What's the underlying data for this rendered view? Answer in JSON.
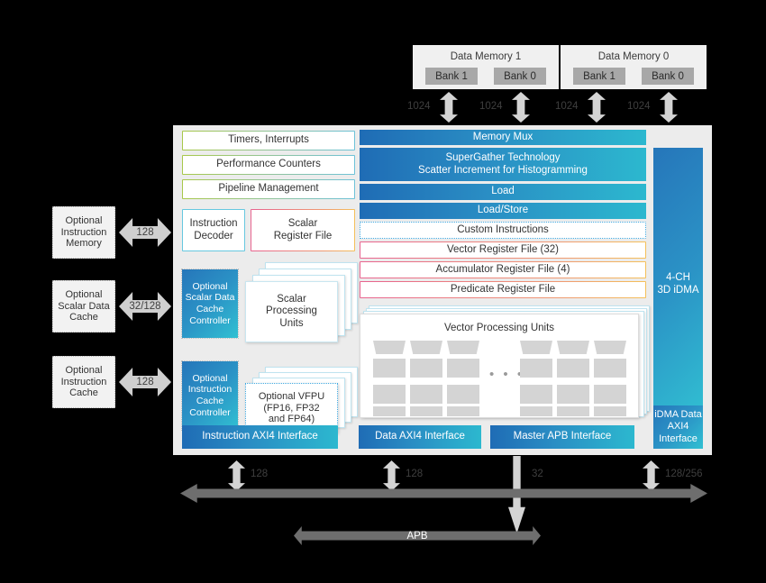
{
  "memories": [
    {
      "title": "Data Memory 1",
      "banks": [
        "Bank 1",
        "Bank 0"
      ]
    },
    {
      "title": "Data Memory 0",
      "banks": [
        "Bank 1",
        "Bank 0"
      ]
    }
  ],
  "memory_bus_labels": [
    "1024",
    "1024",
    "1024",
    "1024"
  ],
  "left_blocks": [
    {
      "label": "Optional\nInstruction\nMemory",
      "width": "128"
    },
    {
      "label": "Optional\nScalar Data\nCache",
      "width": "32/128"
    },
    {
      "label": "Optional\nInstruction\nCache",
      "width": "128"
    }
  ],
  "left_block_lines": [
    [
      "Optional",
      "Instruction",
      "Memory"
    ],
    [
      "Optional",
      "Scalar Data",
      "Cache"
    ],
    [
      "Optional",
      "Instruction",
      "Cache"
    ]
  ],
  "left_arrow_labels": [
    "128",
    "32/128",
    "128"
  ],
  "control_blocks": [
    "Timers, Interrupts",
    "Performance Counters",
    "Pipeline Management"
  ],
  "decoder": "Instruction\nDecoder",
  "decoder_lines": [
    "Instruction",
    "Decoder"
  ],
  "scalar_register_file_lines": [
    "Scalar",
    "Register File"
  ],
  "cache_controllers": [
    [
      "Optional",
      "Scalar Data",
      "Cache",
      "Controller"
    ],
    [
      "Optional",
      "Instruction",
      "Cache",
      "Controller"
    ]
  ],
  "scalar_units_lines": [
    "Scalar",
    "Processing",
    "Units"
  ],
  "vfpu_lines": [
    "Optional VFPU",
    "(FP16, FP32",
    "and FP64)"
  ],
  "pipeline_bars": [
    {
      "label": "Memory Mux",
      "style": "gradient"
    },
    {
      "label": "SuperGather Technology\nScatter Increment for Histogramming",
      "style": "gradient"
    },
    {
      "label": "Load",
      "style": "gradient"
    },
    {
      "label": "Load/Store",
      "style": "gradient"
    },
    {
      "label": "Custom Instructions",
      "style": "dotted"
    },
    {
      "label": "Vector Register File (32)",
      "style": "pink"
    },
    {
      "label": "Accumulator Register File (4)",
      "style": "pink"
    },
    {
      "label": "Predicate Register File",
      "style": "pink"
    }
  ],
  "supergather_lines": [
    "SuperGather Technology",
    "Scatter Increment for Histogramming"
  ],
  "vpu_title": "Vector Processing Units",
  "vpu_ellipsis": "• • •",
  "idma": {
    "label_lines": [
      "4-CH",
      "3D iDMA"
    ],
    "interface_lines": [
      "iDMA Data",
      "AXI4",
      "Interface"
    ]
  },
  "bottom_interfaces": [
    "Instruction AXI4 Interface",
    "Data AXI4 Interface",
    "Master APB Interface"
  ],
  "bottom_bus_labels": [
    "128",
    "128",
    "32",
    "128/256"
  ],
  "buses": {
    "main": "",
    "apb": "APB"
  },
  "colors": {
    "gradient_start": "#1f6cb5",
    "gradient_end": "#2cb8cf",
    "panel_bg": "#ececec",
    "memory_bg": "#f0f0f0",
    "bank_bg": "#a8a8a8",
    "arrow_gray": "#d4d4d4",
    "bus_gray": "#6e6e6e",
    "border_green": "#a8c84a",
    "border_pink": "#e8638f",
    "border_cyan": "#66c8e0",
    "border_dotted_blue": "#3fa8e0"
  }
}
